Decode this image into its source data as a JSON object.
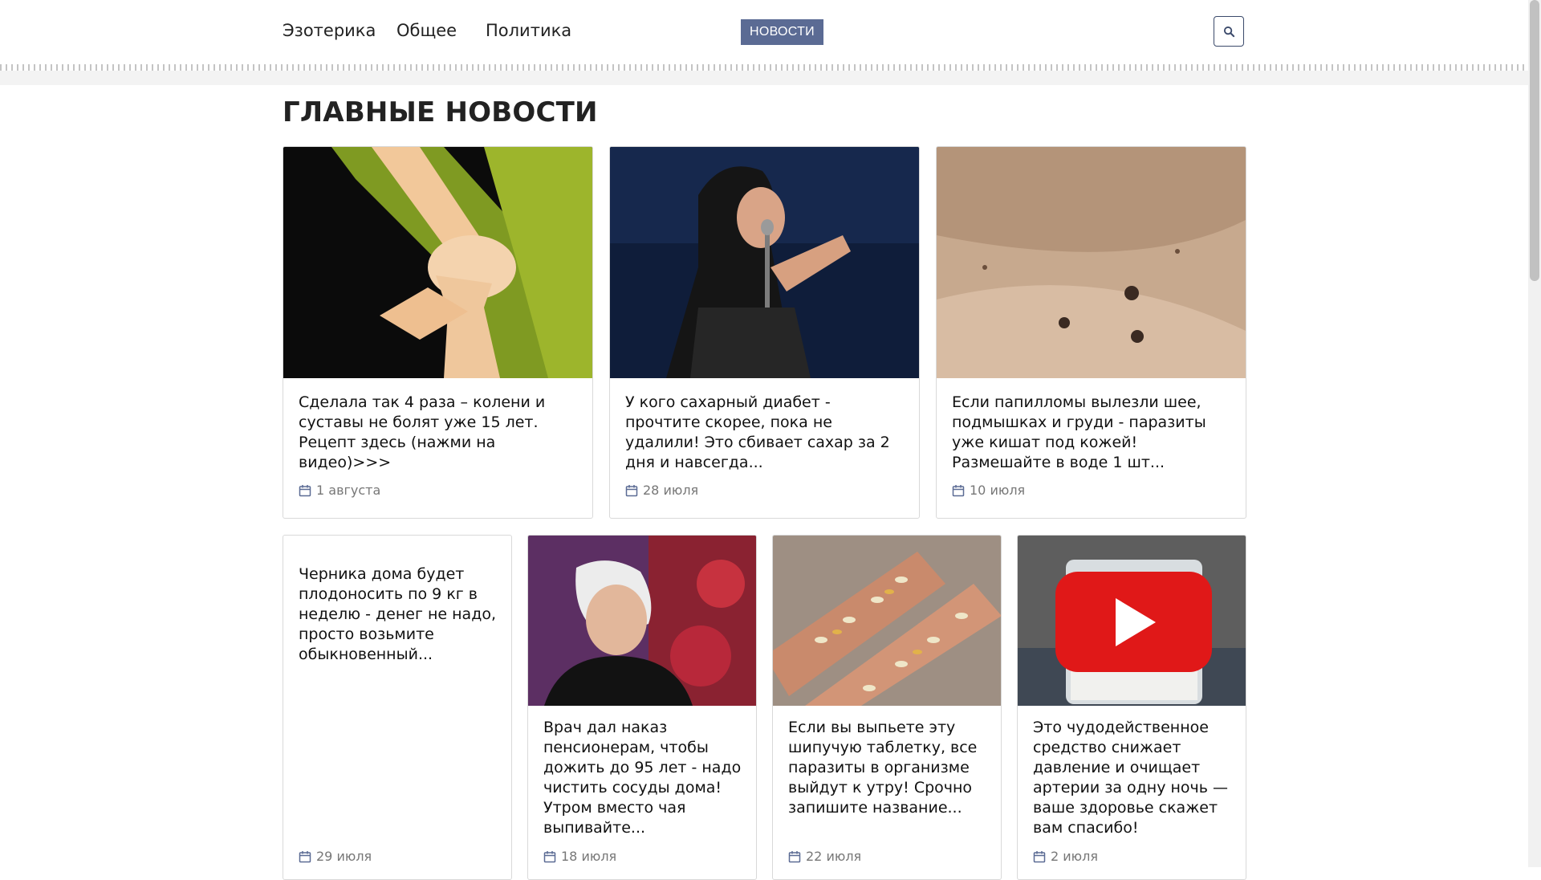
{
  "nav": {
    "items": [
      {
        "label": "Эзотерика"
      },
      {
        "label": "Общее"
      },
      {
        "label": "Политика"
      }
    ],
    "news_button": "НОВОСТИ",
    "search_icon": "search-icon"
  },
  "main": {
    "heading": "ГЛАВНЫЕ НОВОСТИ",
    "cards": [
      {
        "title": "Сделала так 4 раза – колени и суставы не болят уже 15 лет. Рецепт здесь (нажми на видео)>>>",
        "date": "1 августа"
      },
      {
        "title": "У кого сахарный диабет - прочтите скорее, пока не удалили! Это сбивает сахар за 2 дня и навсегда...",
        "date": "28 июля"
      },
      {
        "title": "Если папилломы вылезли шее, подмышках и груди - паразиты уже кишат под кожей! Размешайте в воде 1 шт...",
        "date": "10 июля"
      },
      {
        "title": "Черника дома будет плодоносить по 9 кг в неделю - денег не надо, просто возьмите обыкновенный...",
        "date": "29 июля"
      },
      {
        "title": "Врач дал наказ пенсионерам, чтобы дожить до 95 лет - надо чистить сосуды дома! Утром вместо чая выпивайте...",
        "date": "18 июля"
      },
      {
        "title": "Если вы выпьете эту шипучую таблетку, все паразиты в организме выйдут к утру! Срочно запишите название...",
        "date": "22 июля"
      },
      {
        "title": "Это чудодейственное средство снижает давление и очищает артерии за одну ночь — ваше здоровье скажет вам спасибо!",
        "date": "2 июля"
      }
    ]
  },
  "colors": {
    "accent": "#5b6b94",
    "search_border": "#3b4a6b",
    "date_icon": "#5b6b94"
  }
}
